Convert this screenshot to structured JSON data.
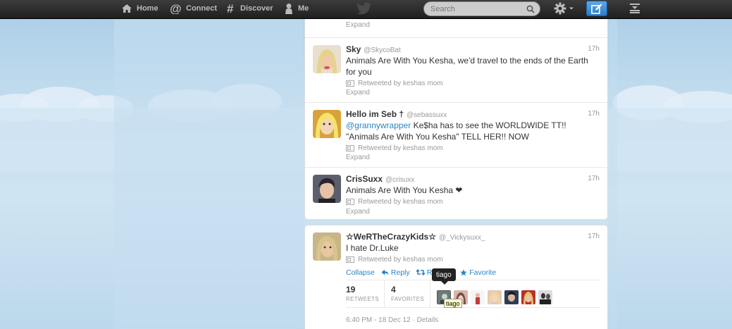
{
  "nav": {
    "home": "Home",
    "connect": "Connect",
    "discover": "Discover",
    "me": "Me"
  },
  "search": {
    "placeholder": "Search"
  },
  "stream": {
    "top_expand": "Expand",
    "tweets": [
      {
        "fullname": "Sky",
        "username": "@SkycoBat",
        "time": "17h",
        "text": "Animals Are With You Kesha, we'd travel to the ends of the Earth for you",
        "retweeted_by": "Retweeted by keshas mom",
        "expand": "Expand"
      },
      {
        "fullname": "Hello im Seb †",
        "username": "@sebassuxx",
        "time": "17h",
        "mention": "@grannywrapper",
        "text": " Ke$ha has to see the WORLDWIDE TT!! \"Animals Are With You Kesha\" TELL HER!! NOW",
        "retweeted_by": "Retweeted by keshas mom",
        "expand": "Expand"
      },
      {
        "fullname": "CrisSuxx",
        "username": "@crisuxx",
        "time": "17h",
        "text": "Animals Are With You Kesha ❤",
        "retweeted_by": "Retweeted by keshas mom",
        "expand": "Expand"
      }
    ]
  },
  "expanded": {
    "fullname": "☆WeRTheCrazyKids☆",
    "username": "@_Vickysuxx_",
    "time": "17h",
    "text": "I hate Dr.Luke",
    "retweeted_by": "Retweeted by keshas mom",
    "actions": {
      "collapse": "Collapse",
      "reply": "Reply",
      "retweet": "Retweet",
      "favorite": "Favorite"
    },
    "retweets": {
      "count": "19",
      "label": "RETWEETS"
    },
    "favorites": {
      "count": "4",
      "label": "FAVORITES"
    },
    "date": "6:40 PM - 18 Dec 12 · Details",
    "tooltip": "tiago",
    "tooltip_title": "tiago"
  },
  "colors": {
    "link": "#2a84c6",
    "topbar": "#2a2a2a",
    "compose": "#2a7cc8"
  }
}
